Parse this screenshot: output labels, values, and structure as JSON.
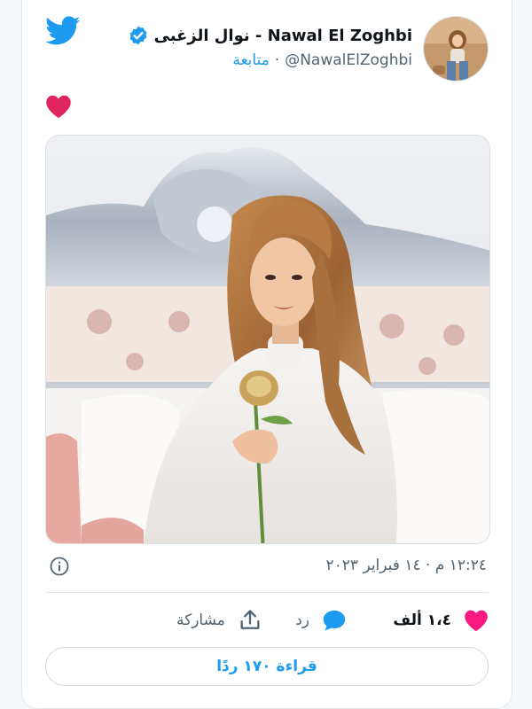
{
  "tweet": {
    "display_name": "نوال الزغبى - Nawal El Zoghbi",
    "handle": "@NawalElZoghbi",
    "separator": "·",
    "follow_label": "متابعة",
    "verified": true,
    "body_emoji": "heart",
    "timestamp": "١٢:٢٤ م · ١٤ فبراير ٢٠٢٣",
    "likes_count": "١،٤ ألف",
    "reply_label": "رد",
    "share_label": "مشاركة",
    "read_replies_label": "قراءة ١٧٠ ردًا"
  },
  "icons": {
    "brand": "twitter-bird-icon",
    "verified": "verified-badge-icon",
    "info": "info-icon",
    "like": "heart-icon",
    "reply": "speech-bubble-icon",
    "share": "share-upload-icon"
  },
  "colors": {
    "twitter_blue": "#1d9bf0",
    "like_pink": "#f91880",
    "emoji_red": "#e0245e",
    "text_primary": "#0f1419",
    "text_secondary": "#536471"
  }
}
